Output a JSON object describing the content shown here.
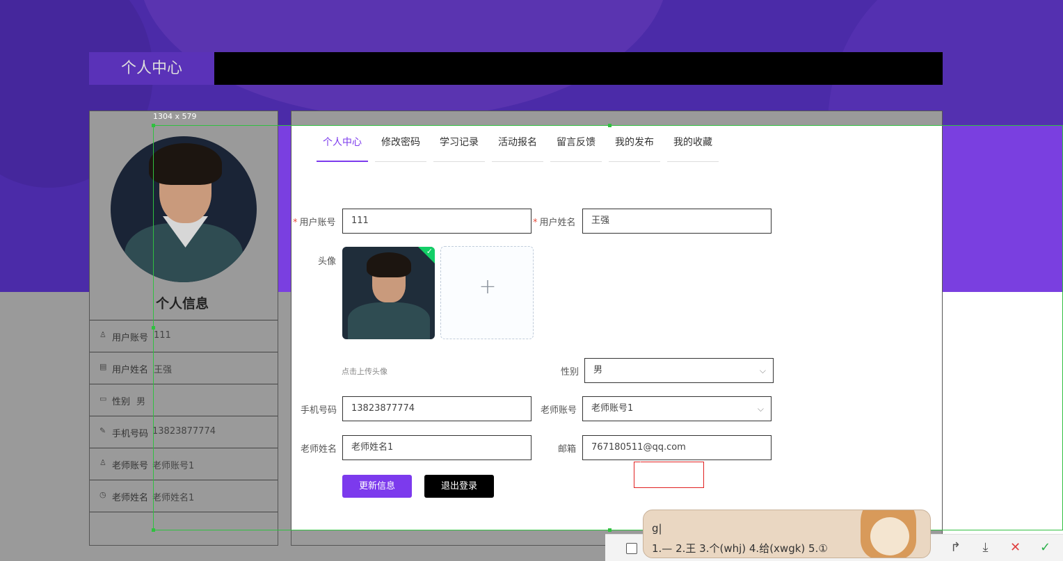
{
  "header": {
    "title": "个人中心"
  },
  "selection": {
    "size_label": "1304 x 579"
  },
  "left_panel": {
    "info_title": "个人信息",
    "rows": [
      {
        "label": "用户账号",
        "value": "111"
      },
      {
        "label": "用户姓名",
        "value": "王强"
      },
      {
        "label": "性别",
        "value": "男"
      },
      {
        "label": "手机号码",
        "value": "13823877774"
      },
      {
        "label": "老师账号",
        "value": "老师账号1"
      },
      {
        "label": "老师姓名",
        "value": "老师姓名1"
      }
    ]
  },
  "tabs": [
    {
      "label": "个人中心",
      "active": true
    },
    {
      "label": "修改密码"
    },
    {
      "label": "学习记录"
    },
    {
      "label": "活动报名"
    },
    {
      "label": "留言反馈"
    },
    {
      "label": "我的发布"
    },
    {
      "label": "我的收藏"
    }
  ],
  "form": {
    "account": {
      "label": "用户账号",
      "value": "111"
    },
    "name": {
      "label": "用户姓名",
      "value": "王强"
    },
    "avatar": {
      "label": "头像",
      "hint": "点击上传头像"
    },
    "gender": {
      "label": "性别",
      "value": "男"
    },
    "phone": {
      "label": "手机号码",
      "value": "13823877774"
    },
    "teacher_account": {
      "label": "老师账号",
      "value": "老师账号1"
    },
    "teacher_name": {
      "label": "老师姓名",
      "value": "老师姓名1"
    },
    "email": {
      "label": "邮箱",
      "value": "767180511@qq.com"
    },
    "required_mark": "*",
    "update_button": "更新信息",
    "logout_button": "退出登录"
  },
  "ime": {
    "input": "g|",
    "candidates": "1.— 2.王 3.个(whj) 4.给(xwgk) 5.①"
  },
  "colors": {
    "accent": "#7c3aed",
    "header_bg": "#000000",
    "bg_purple": "#4b2ba8"
  }
}
